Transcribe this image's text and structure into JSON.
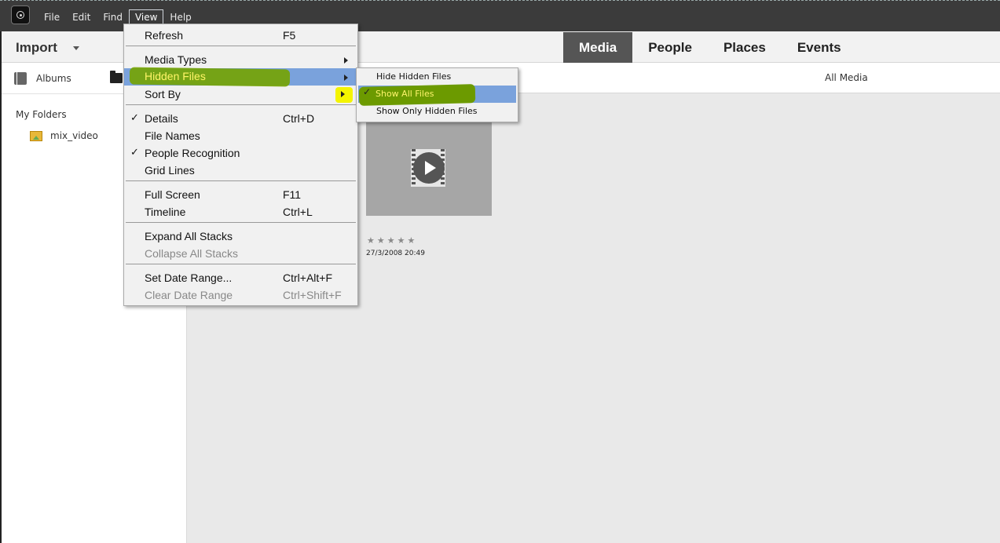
{
  "menubar": {
    "file": "File",
    "edit": "Edit",
    "find": "Find",
    "view": "View",
    "help": "Help"
  },
  "header": {
    "import_label": "Import"
  },
  "tabs": [
    {
      "label": "Media",
      "active": true
    },
    {
      "label": "People"
    },
    {
      "label": "Places"
    },
    {
      "label": "Events"
    }
  ],
  "sidebar": {
    "albums_label": "Albums",
    "my_folders": "My Folders",
    "folder_name": "mix_video"
  },
  "toolbar": {
    "filter_label": "All Media"
  },
  "media_item": {
    "stars": "★★★★★",
    "date": "27/3/2008 20:49"
  },
  "view_menu": {
    "items": [
      {
        "label": "Refresh",
        "shortcut": "F5"
      },
      {
        "label": "Media Types"
      },
      {
        "label": "Hidden Files"
      },
      {
        "label": "Sort By"
      },
      {
        "label": "Details",
        "shortcut": "Ctrl+D",
        "checked": true
      },
      {
        "label": "File Names"
      },
      {
        "label": "People Recognition",
        "checked": true
      },
      {
        "label": "Grid Lines"
      },
      {
        "label": "Full Screen",
        "shortcut": "F11"
      },
      {
        "label": "Timeline",
        "shortcut": "Ctrl+L"
      },
      {
        "label": "Expand All Stacks"
      },
      {
        "label": "Collapse All Stacks",
        "disabled": true
      },
      {
        "label": "Set Date Range...",
        "shortcut": "Ctrl+Alt+F"
      },
      {
        "label": "Clear Date Range",
        "shortcut": "Ctrl+Shift+F",
        "disabled": true
      }
    ],
    "check_mark": "✓"
  },
  "hidden_files_submenu": {
    "items": [
      {
        "label": "Hide Hidden Files"
      },
      {
        "label": "Show All Files",
        "checked": true
      },
      {
        "label": "Show Only Hidden Files"
      }
    ],
    "check_mark": "✓"
  },
  "colors": {
    "menu_highlight": "#7aa2dc",
    "annotation_green": "#74a300",
    "annotation_yellow": "#f4f400",
    "active_tab": "#555555"
  }
}
